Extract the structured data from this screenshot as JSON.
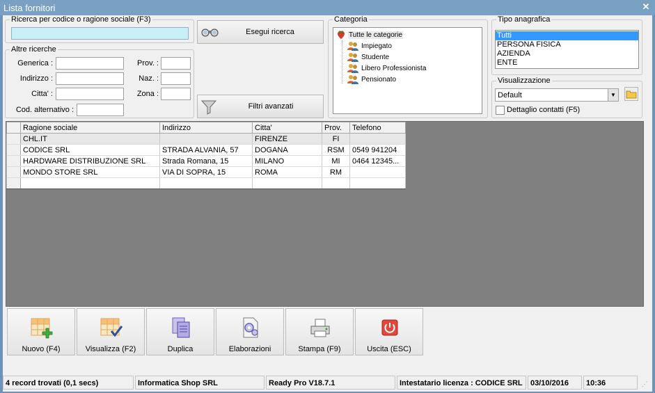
{
  "window": {
    "title": "Lista fornitori"
  },
  "search": {
    "group_label": "Ricerca per codice o ragione sociale (F3)",
    "value": "",
    "run_label": "Esegui ricerca",
    "advanced_label": "Filtri avanzati"
  },
  "other": {
    "group_label": "Altre ricerche",
    "generica_label": "Generica :",
    "indirizzo_label": "Indirizzo :",
    "citta_label": "Citta' :",
    "cod_alt_label": "Cod. alternativo :",
    "prov_label": "Prov. :",
    "naz_label": "Naz. :",
    "zona_label": "Zona :"
  },
  "category": {
    "group_label": "Categoria",
    "root": "Tutte le categorie",
    "items": [
      "Impiegato",
      "Studente",
      "Libero Professionista",
      "Pensionato"
    ]
  },
  "tipo": {
    "group_label": "Tipo anagrafica",
    "items": [
      "Tutti",
      "PERSONA FISICA",
      "AZIENDA",
      "ENTE"
    ],
    "selected": "Tutti"
  },
  "visual": {
    "group_label": "Visualizzazione",
    "selected": "Default",
    "detail_label": "Dettaglio contatti (F5)",
    "detail_checked": false
  },
  "grid": {
    "headers": [
      "Ragione sociale",
      "Indirizzo",
      "Citta'",
      "Prov.",
      "Telefono"
    ],
    "rows": [
      [
        "CHL.IT",
        "",
        "FIRENZE",
        "FI",
        ""
      ],
      [
        "CODICE SRL",
        "STRADA ALVANIA, 57",
        "DOGANA",
        "RSM",
        "0549 941204"
      ],
      [
        "HARDWARE DISTRIBUZIONE SRL",
        "Strada Romana, 15",
        "MILANO",
        "MI",
        "0464 12345..."
      ],
      [
        "MONDO STORE SRL",
        "VIA DI SOPRA, 15",
        "ROMA",
        "RM",
        ""
      ],
      [
        "",
        "",
        "",
        "",
        ""
      ]
    ]
  },
  "actions": {
    "nuovo": "Nuovo (F4)",
    "visualizza": "Visualizza (F2)",
    "duplica": "Duplica",
    "elaborazioni": "Elaborazioni",
    "stampa": "Stampa (F9)",
    "uscita": "Uscita (ESC)"
  },
  "status": {
    "records": "4 record trovati (0,1 secs)",
    "company": "Informatica Shop SRL",
    "version": "Ready Pro V18.7.1",
    "license": "Intestatario licenza : CODICE SRL",
    "date": "03/10/2016",
    "time": "10:36"
  }
}
